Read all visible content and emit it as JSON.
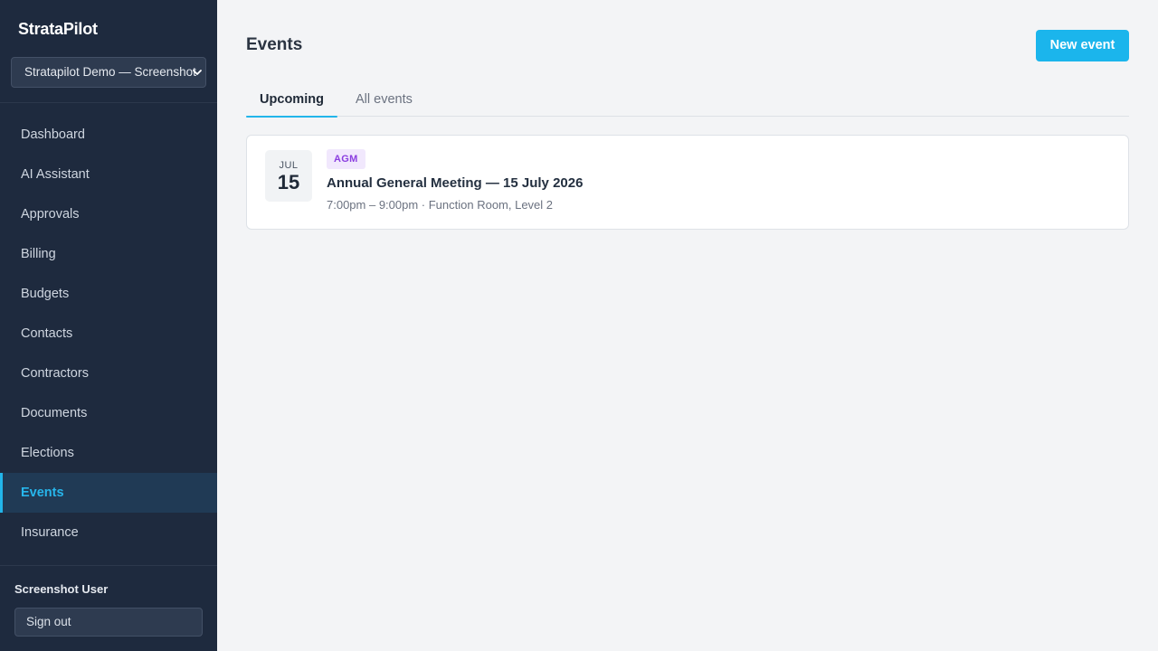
{
  "sidebar": {
    "brand": "StrataPilot",
    "org_select": "Stratapilot Demo — Screenshot",
    "items": [
      {
        "label": "Dashboard"
      },
      {
        "label": "AI Assistant"
      },
      {
        "label": "Approvals"
      },
      {
        "label": "Billing"
      },
      {
        "label": "Budgets"
      },
      {
        "label": "Contacts"
      },
      {
        "label": "Contractors"
      },
      {
        "label": "Documents"
      },
      {
        "label": "Elections"
      },
      {
        "label": "Events"
      },
      {
        "label": "Insurance"
      }
    ],
    "active_item": "Events",
    "user_name": "Screenshot User",
    "signout_label": "Sign out"
  },
  "header": {
    "title": "Events",
    "new_button_label": "New event"
  },
  "tabs": [
    {
      "label": "Upcoming",
      "active": true
    },
    {
      "label": "All events",
      "active": false
    }
  ],
  "events": [
    {
      "month": "JUL",
      "day": "15",
      "badge": "AGM",
      "title": "Annual General Meeting — 15 July 2026",
      "meta": "7:00pm – 9:00pm · Function Room, Level 2"
    }
  ],
  "colors": {
    "accent": "#1bb5ec",
    "sidebar_bg": "#1e2a3e",
    "badge_bg": "#f1e8fd",
    "badge_text": "#8b3ee0"
  }
}
